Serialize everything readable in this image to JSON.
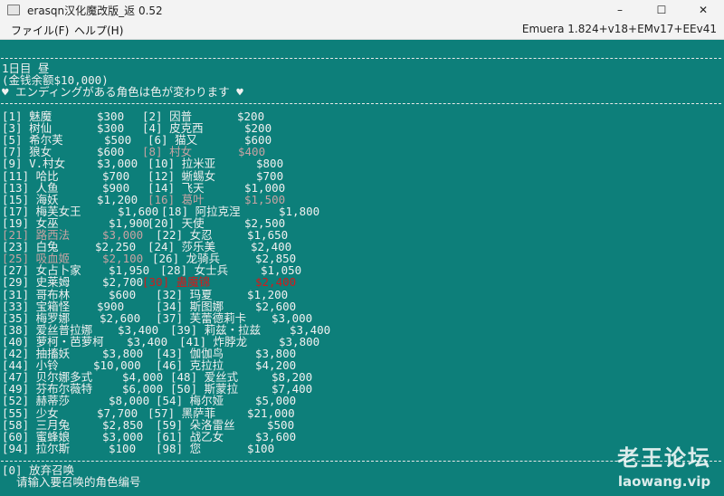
{
  "window": {
    "title": "erasqn汉化魔改版_返 0.52",
    "minimize": "–",
    "maximize": "☐",
    "close": "✕"
  },
  "menu": {
    "file": "ファイル(F)",
    "help": "ヘルプ(H)",
    "version": "Emuera 1.824+v18+EMv17+EEv41"
  },
  "header": {
    "day": "1日目 昼",
    "money": "(金钱余额$10,000)",
    "notice": "♥ エンディングがある角色は色が変わります ♥"
  },
  "entries": [
    {
      "id": "[1]",
      "name": "魅魔",
      "price": "$300",
      "state": "normal"
    },
    {
      "id": "[2]",
      "name": "因普",
      "price": "$200",
      "state": "normal"
    },
    {
      "id": "[3]",
      "name": "树仙",
      "price": "$300",
      "state": "normal"
    },
    {
      "id": "[4]",
      "name": "皮克西",
      "price": "$200",
      "state": "normal"
    },
    {
      "id": "[5]",
      "name": "希尔芙",
      "price": "$500",
      "state": "normal"
    },
    {
      "id": "[6]",
      "name": "猫又",
      "price": "$600",
      "state": "normal"
    },
    {
      "id": "[7]",
      "name": "狼女",
      "price": "$600",
      "state": "normal"
    },
    {
      "id": "[8]",
      "name": "村女",
      "price": "$400",
      "state": "unavail"
    },
    {
      "id": "[9]",
      "name": "V.村女",
      "price": "$3,000",
      "state": "normal"
    },
    {
      "id": "[10]",
      "name": "拉米亚",
      "price": "$800",
      "state": "normal"
    },
    {
      "id": "[11]",
      "name": "哈比",
      "price": "$700",
      "state": "normal"
    },
    {
      "id": "[12]",
      "name": "蜥蜴女",
      "price": "$700",
      "state": "normal"
    },
    {
      "id": "[13]",
      "name": "人鱼",
      "price": "$900",
      "state": "normal"
    },
    {
      "id": "[14]",
      "name": "飞天",
      "price": "$1,000",
      "state": "normal"
    },
    {
      "id": "[15]",
      "name": "海妖",
      "price": "$1,200",
      "state": "normal"
    },
    {
      "id": "[16]",
      "name": "葛叶",
      "price": "$1,500",
      "state": "unavail"
    },
    {
      "id": "[17]",
      "name": "梅芙女王",
      "price": "$1,600",
      "state": "normal"
    },
    {
      "id": "[18]",
      "name": "阿拉克涅",
      "price": "$1,800",
      "state": "normal"
    },
    {
      "id": "[19]",
      "name": "女巫",
      "price": "$1,900",
      "state": "normal"
    },
    {
      "id": "[20]",
      "name": "天使",
      "price": "$2,500",
      "state": "normal"
    },
    {
      "id": "[21]",
      "name": "路西法",
      "price": "$3,000",
      "state": "unavail"
    },
    {
      "id": "[22]",
      "name": "女忍",
      "price": "$1,650",
      "state": "normal"
    },
    {
      "id": "[23]",
      "name": "白兔",
      "price": "$2,250",
      "state": "normal"
    },
    {
      "id": "[24]",
      "name": "莎乐美",
      "price": "$2,400",
      "state": "normal"
    },
    {
      "id": "[25]",
      "name": "吸血姬",
      "price": "$2,100",
      "state": "unavail"
    },
    {
      "id": "[26]",
      "name": "龙骑兵",
      "price": "$2,850",
      "state": "normal"
    },
    {
      "id": "[27]",
      "name": "女占卜家",
      "price": "$1,950",
      "state": "normal"
    },
    {
      "id": "[28]",
      "name": "女士兵",
      "price": "$1,050",
      "state": "normal"
    },
    {
      "id": "[29]",
      "name": "史莱姆",
      "price": "$2,700",
      "state": "normal"
    },
    {
      "id": "[30]",
      "name": "蛊魔锦",
      "price": "$2,400",
      "state": "selected"
    },
    {
      "id": "[31]",
      "name": "哥布林",
      "price": "$600",
      "state": "normal"
    },
    {
      "id": "[32]",
      "name": "玛夏",
      "price": "$1,200",
      "state": "normal"
    },
    {
      "id": "[33]",
      "name": "宝箱怪",
      "price": "$900",
      "state": "normal"
    },
    {
      "id": "[34]",
      "name": "斯图娜",
      "price": "$2,600",
      "state": "normal"
    },
    {
      "id": "[35]",
      "name": "梅罗娜",
      "price": "$2,600",
      "state": "normal"
    },
    {
      "id": "[37]",
      "name": "芙蕾德莉卡",
      "price": "$3,000",
      "state": "normal"
    },
    {
      "id": "[38]",
      "name": "爱丝普拉娜",
      "price": "$3,400",
      "state": "normal"
    },
    {
      "id": "[39]",
      "name": "莉兹・拉兹",
      "price": "$3,400",
      "state": "normal"
    },
    {
      "id": "[40]",
      "name": "萝柯・芭萝柯",
      "price": "$3,400",
      "state": "normal"
    },
    {
      "id": "[41]",
      "name": "炸脖龙",
      "price": "$3,800",
      "state": "normal"
    },
    {
      "id": "[42]",
      "name": "抽搐妖",
      "price": "$3,800",
      "state": "normal"
    },
    {
      "id": "[43]",
      "name": "伽伽鸟",
      "price": "$3,800",
      "state": "normal"
    },
    {
      "id": "[44]",
      "name": "小铃",
      "price": "$10,000",
      "state": "normal"
    },
    {
      "id": "[46]",
      "name": "克拉拉",
      "price": "$4,200",
      "state": "normal"
    },
    {
      "id": "[47]",
      "name": "贝尔娜多式",
      "price": "$4,000",
      "state": "normal"
    },
    {
      "id": "[48]",
      "name": "爱丝式",
      "price": "$8,200",
      "state": "normal"
    },
    {
      "id": "[49]",
      "name": "芬布尔薇特",
      "price": "$6,000",
      "state": "normal"
    },
    {
      "id": "[50]",
      "name": "斯蒙拉",
      "price": "$7,400",
      "state": "normal"
    },
    {
      "id": "[52]",
      "name": "赫蒂莎",
      "price": "$8,000",
      "state": "normal"
    },
    {
      "id": "[54]",
      "name": "梅尔娅",
      "price": "$5,000",
      "state": "normal"
    },
    {
      "id": "[55]",
      "name": "少女",
      "price": "$7,700",
      "state": "normal"
    },
    {
      "id": "[57]",
      "name": "黑萨菲",
      "price": "$21,000",
      "state": "normal"
    },
    {
      "id": "[58]",
      "name": "三月兔",
      "price": "$2,850",
      "state": "normal"
    },
    {
      "id": "[59]",
      "name": "朵洛雷丝",
      "price": "$500",
      "state": "normal"
    },
    {
      "id": "[60]",
      "name": "蜜蜂娘",
      "price": "$3,000",
      "state": "normal"
    },
    {
      "id": "[61]",
      "name": "战乙女",
      "price": "$3,600",
      "state": "normal"
    },
    {
      "id": "[94]",
      "name": "拉尔斯",
      "price": "$100",
      "state": "normal"
    },
    {
      "id": "[98]",
      "name": "您",
      "price": "$100",
      "state": "normal"
    }
  ],
  "footer": {
    "cancel": "[0] 放弃召唤",
    "prompt": "请输入要召唤的角色编号"
  },
  "watermark": {
    "title": "老王论坛",
    "url": "laowang.vip"
  }
}
